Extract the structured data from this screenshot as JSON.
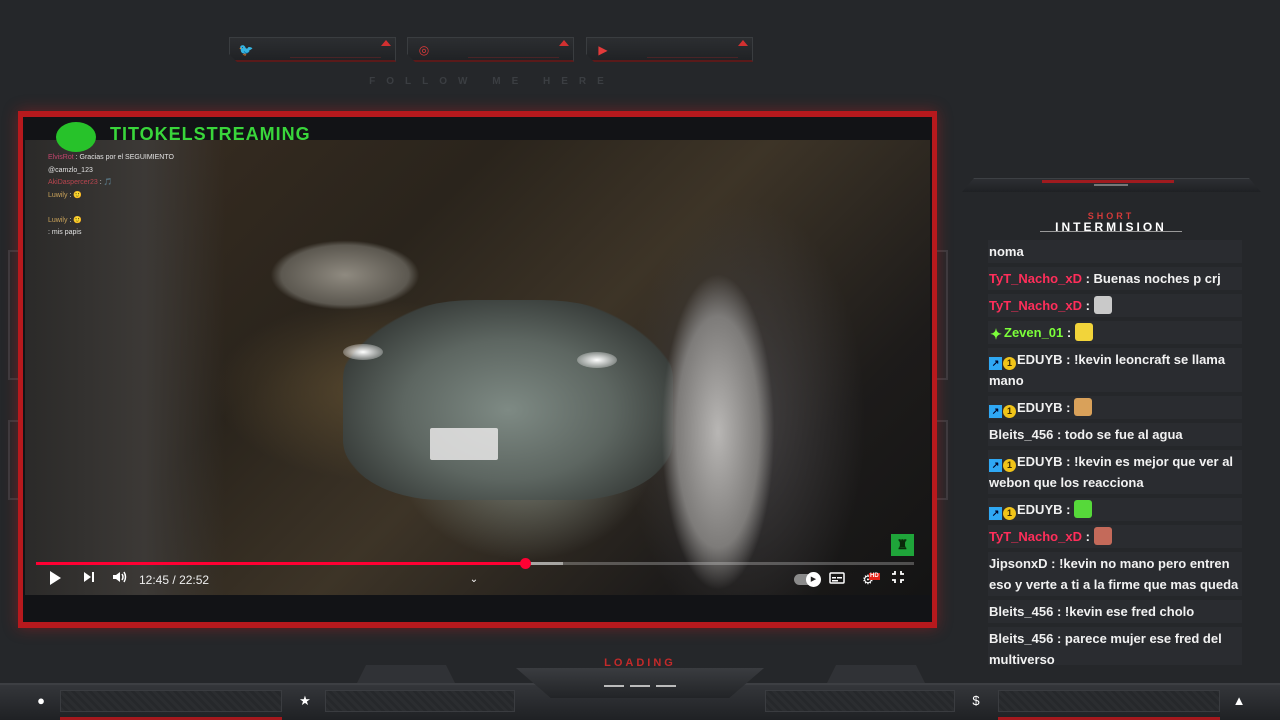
{
  "social": {
    "items": [
      {
        "icon": "twitter-icon",
        "glyph": "🐦"
      },
      {
        "icon": "instagram-icon",
        "glyph": "◎"
      },
      {
        "icon": "youtube-icon",
        "glyph": "▶"
      }
    ],
    "tagline": "FOLLOW ME HERE"
  },
  "player": {
    "channel_name": "TITOKELSTREAMING",
    "current_time": "12:45",
    "separator": "/",
    "duration": "22:52",
    "progress_fraction": 0.557,
    "buffer_fraction": 0.6,
    "hd_label": "HD",
    "mini_chat": [
      {
        "user": "ElvisRot",
        "text": ": Gracias por el SEGUIMIENTO"
      },
      {
        "user": "",
        "text": "@camzlo_123"
      },
      {
        "user": "AkiDaspercer23",
        "text": ": 🎵"
      },
      {
        "user": "Luwily",
        "text": ": 🙂"
      },
      {
        "user": "",
        "text": ""
      },
      {
        "user": "Luwily",
        "text": ": 🙂"
      },
      {
        "user": "",
        "text": ": mis papis"
      }
    ]
  },
  "chat": {
    "title_small": "SHORT",
    "title": "INTERMISION",
    "messages": [
      {
        "badges": [],
        "name": "",
        "name_color": "white",
        "text": "noma"
      },
      {
        "badges": [],
        "name": "TyT_Nacho_xD",
        "name_color": "red",
        "text": ": Buenas noches p crj"
      },
      {
        "badges": [],
        "name": "TyT_Nacho_xD",
        "name_color": "red",
        "text": ":",
        "emote": "#c9c9c9"
      },
      {
        "badges": [
          "green"
        ],
        "name": "Zeven_01",
        "name_color": "green",
        "text": ":",
        "emote": "#f2d43a"
      },
      {
        "badges": [
          "sub",
          "gold"
        ],
        "name": "EDUYB",
        "name_color": "white",
        "text": ": !kevin leoncraft se llama mano"
      },
      {
        "badges": [
          "sub",
          "gold"
        ],
        "name": "EDUYB",
        "name_color": "white",
        "text": ":",
        "emote": "#d9a15a"
      },
      {
        "badges": [],
        "name": "Bleits_456",
        "name_color": "white",
        "text": ": todo se fue al agua"
      },
      {
        "badges": [
          "sub",
          "gold"
        ],
        "name": "EDUYB",
        "name_color": "white",
        "text": ": !kevin es mejor que ver al webon que los reacciona"
      },
      {
        "badges": [
          "sub",
          "gold"
        ],
        "name": "EDUYB",
        "name_color": "white",
        "text": ":",
        "emote": "#56d93a"
      },
      {
        "badges": [],
        "name": "TyT_Nacho_xD",
        "name_color": "red",
        "text": ":",
        "emote": "#c46a5a"
      },
      {
        "badges": [],
        "name": "JipsonxD",
        "name_color": "white",
        "text": ": !kevin no mano pero entren eso y verte a ti a la firme que mas queda"
      },
      {
        "badges": [],
        "name": "Bleits_456",
        "name_color": "white",
        "text": ": !kevin ese fred cholo"
      },
      {
        "badges": [],
        "name": "Bleits_456",
        "name_color": "white",
        "text": ": parece mujer ese fred del multiverso"
      }
    ]
  },
  "footer": {
    "loading": "LOADING",
    "icons": [
      {
        "name": "user-icon",
        "glyph": "●"
      },
      {
        "name": "star-icon",
        "glyph": "★"
      },
      {
        "name": "dollar-icon",
        "glyph": "$"
      },
      {
        "name": "rocket-icon",
        "glyph": "▲"
      }
    ]
  },
  "colors": {
    "accent_red": "#b7191d",
    "progress_red": "#ff0033",
    "chat_name_red": "#ff2e5a",
    "chat_name_green": "#7cff3a"
  }
}
